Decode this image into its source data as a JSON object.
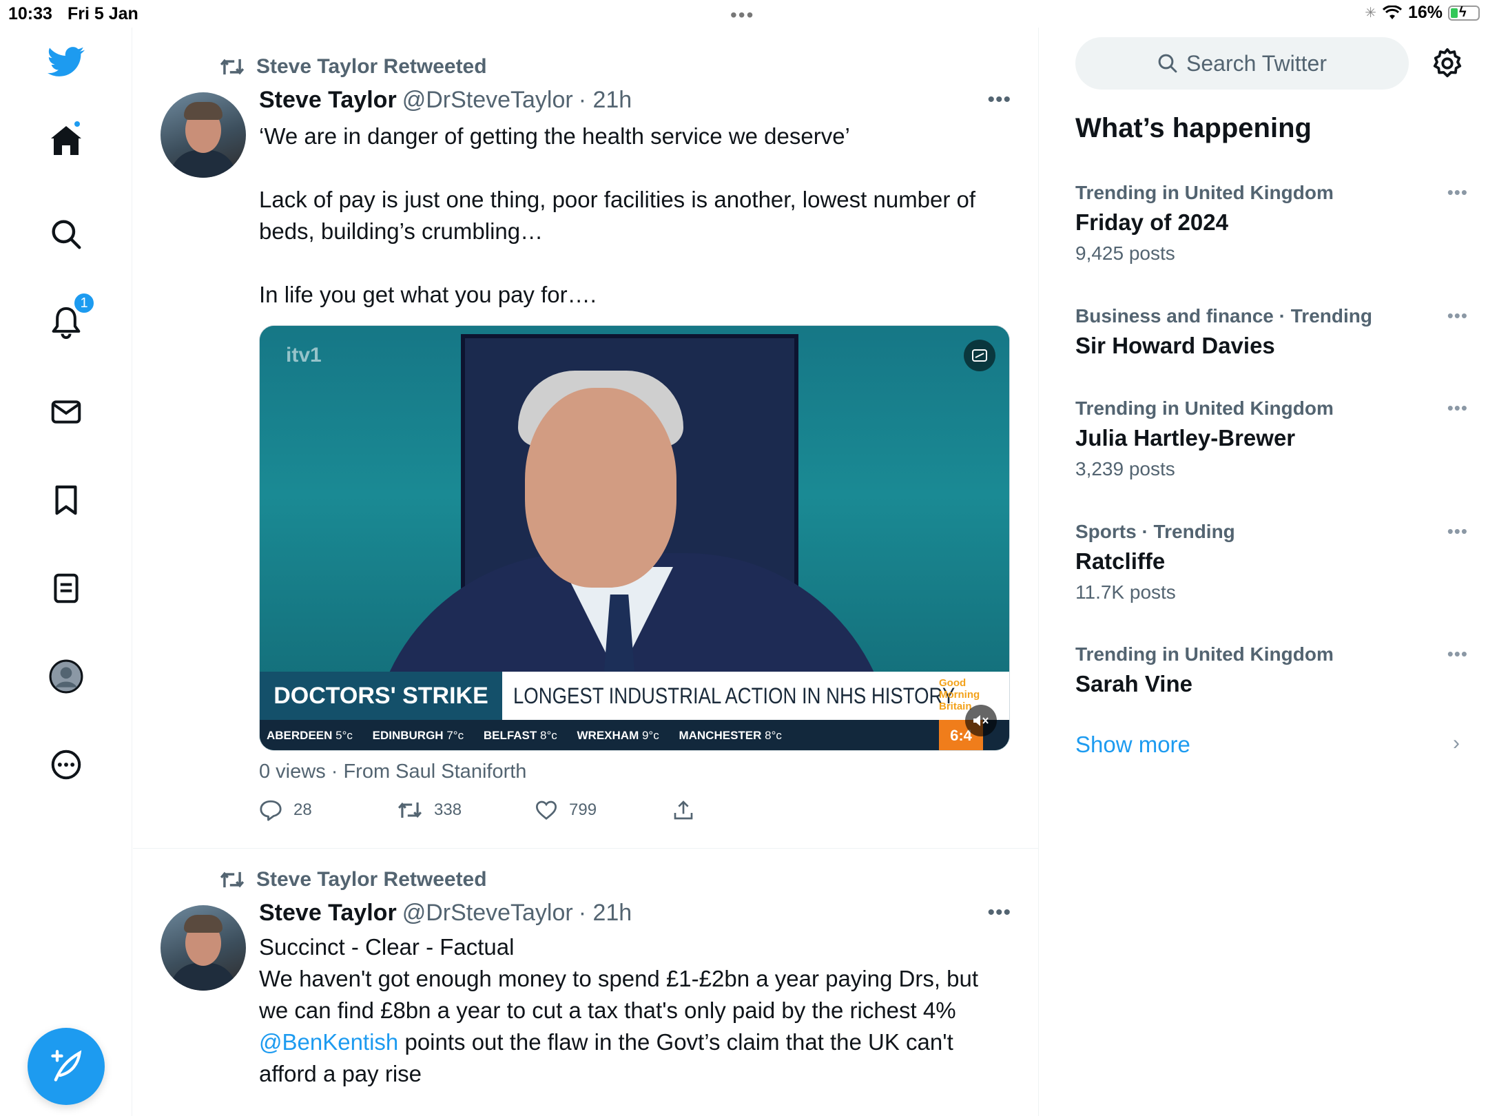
{
  "status_bar": {
    "time": "10:33",
    "date": "Fri 5 Jan",
    "battery": "16%"
  },
  "nav": {
    "home_icon": "home-icon",
    "explore_icon": "search-icon",
    "notifications_badge": "1",
    "items": [
      "home",
      "explore",
      "notifications",
      "messages",
      "bookmarks",
      "lists",
      "profile",
      "more"
    ]
  },
  "tweets": [
    {
      "retweet_label": "Steve Taylor Retweeted",
      "name": "Steve Taylor",
      "handle": "@DrSteveTaylor",
      "time": "· 21h",
      "paragraphs": [
        "‘We are in danger of getting the health service we deserve’",
        "Lack of pay is just one thing, poor facilities is another, lowest number of beds, building’s crumbling…",
        "In life you get what you pay for…."
      ],
      "media": {
        "channel": "itv1",
        "tag": "DOCTORS' STRIKE",
        "headline": "LONGEST INDUSTRIAL ACTION IN NHS HISTORY",
        "show": "Good Morning Britain",
        "clock": "6:4",
        "weather": [
          {
            "city": "ABERDEEN",
            "temp": "5°c"
          },
          {
            "city": "EDINBURGH",
            "temp": "7°c"
          },
          {
            "city": "BELFAST",
            "temp": "8°c"
          },
          {
            "city": "WREXHAM",
            "temp": "9°c"
          },
          {
            "city": "MANCHESTER",
            "temp": "8°c"
          }
        ]
      },
      "views": "0 views · From Saul Staniforth",
      "replies": "28",
      "retweets": "338",
      "likes": "799"
    },
    {
      "retweet_label": "Steve Taylor Retweeted",
      "name": "Steve Taylor",
      "handle": "@DrSteveTaylor",
      "time": "· 21h",
      "line1": "Succinct - Clear - Factual",
      "line2": "We haven't got enough money to spend £1-£2bn a year paying Drs, but we can find £8bn a year to cut a tax that's only paid by the richest 4%",
      "mention": "@BenKentish",
      "line3": " points out the flaw in the Govt’s claim that the UK can't afford a pay rise"
    }
  ],
  "sidebar": {
    "search_placeholder": "Search Twitter",
    "title": "What’s happening",
    "trends": [
      {
        "context": "Trending in United Kingdom",
        "name": "Friday of 2024",
        "count": "9,425 posts"
      },
      {
        "context": "Business and finance · Trending",
        "name": "Sir Howard Davies",
        "count": ""
      },
      {
        "context": "Trending in United Kingdom",
        "name": "Julia Hartley-Brewer",
        "count": "3,239 posts"
      },
      {
        "context": "Sports · Trending",
        "name": "Ratcliffe",
        "count": "11.7K posts"
      },
      {
        "context": "Trending in United Kingdom",
        "name": "Sarah Vine",
        "count": ""
      }
    ],
    "show_more": "Show more"
  },
  "colors": {
    "accent": "#1d9bf0",
    "secondary_text": "#536471",
    "border": "#eff3f4"
  }
}
